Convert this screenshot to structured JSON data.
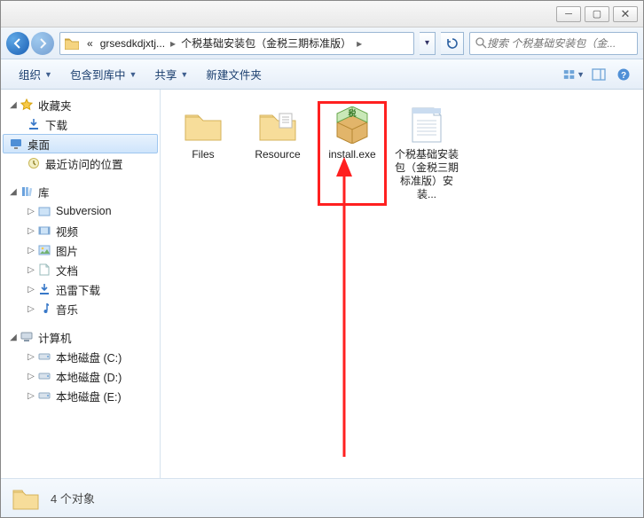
{
  "breadcrumb": {
    "prefix": "«",
    "seg1": "grsesdkdjxtj...",
    "seg2": "个税基础安装包（金税三期标准版）"
  },
  "search": {
    "placeholder": "搜索 个税基础安装包（金..."
  },
  "toolbar": {
    "organize": "组织",
    "include": "包含到库中",
    "share": "共享",
    "newfolder": "新建文件夹"
  },
  "sidebar": {
    "favorites": {
      "label": "收藏夹",
      "items": [
        "下载",
        "桌面",
        "最近访问的位置"
      ]
    },
    "libraries": {
      "label": "库",
      "items": [
        "Subversion",
        "视频",
        "图片",
        "文档",
        "迅雷下载",
        "音乐"
      ]
    },
    "computer": {
      "label": "计算机",
      "items": [
        "本地磁盘 (C:)",
        "本地磁盘 (D:)",
        "本地磁盘 (E:)"
      ]
    }
  },
  "files": {
    "items": [
      {
        "name": "Files",
        "type": "folder"
      },
      {
        "name": "Resource",
        "type": "folder"
      },
      {
        "name": "install.exe",
        "type": "installer",
        "highlight": true
      },
      {
        "name": "个税基础安装包（金税三期标准版）安装...",
        "type": "textfile"
      }
    ]
  },
  "status": {
    "count": "4 个对象"
  }
}
